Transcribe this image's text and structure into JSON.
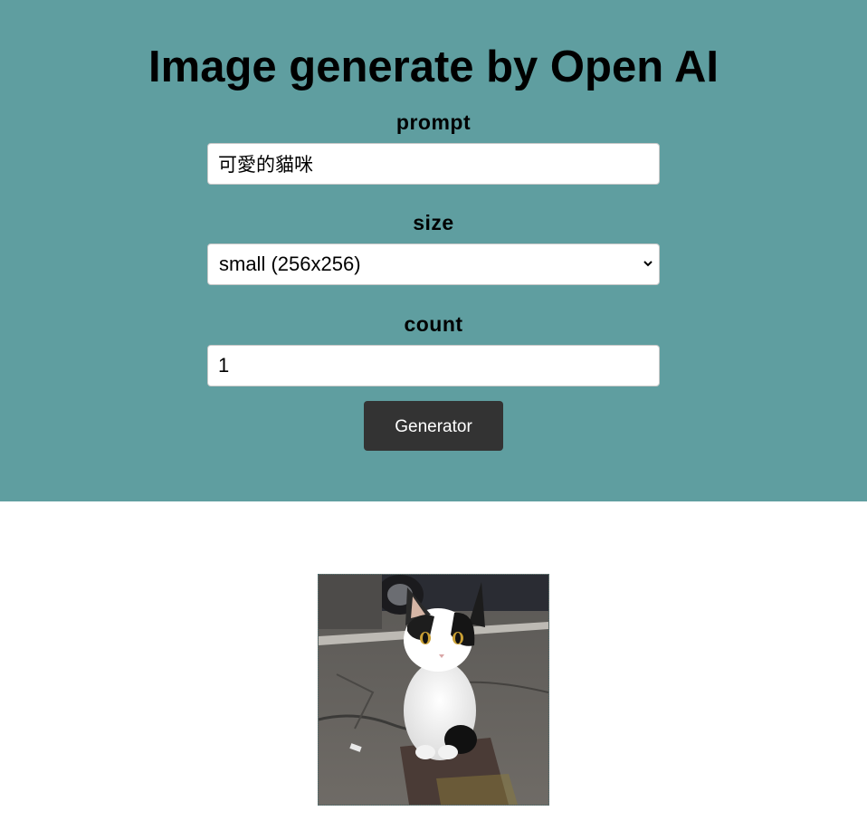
{
  "page": {
    "title": "Image generate by Open AI"
  },
  "form": {
    "prompt_label": "prompt",
    "prompt_value": "可愛的貓咪",
    "size_label": "size",
    "size_selected": "small (256x256)",
    "count_label": "count",
    "count_value": "1",
    "submit_label": "Generator"
  },
  "colors": {
    "header_bg": "#5f9ea0",
    "button_bg": "#333333",
    "button_text": "#ffffff"
  },
  "results": {
    "images": [
      {
        "name": "generated-cat-image",
        "subject": "black-and-white kitten sitting on pavement"
      }
    ]
  },
  "icons": {
    "select_arrow": "chevron-down-icon"
  }
}
